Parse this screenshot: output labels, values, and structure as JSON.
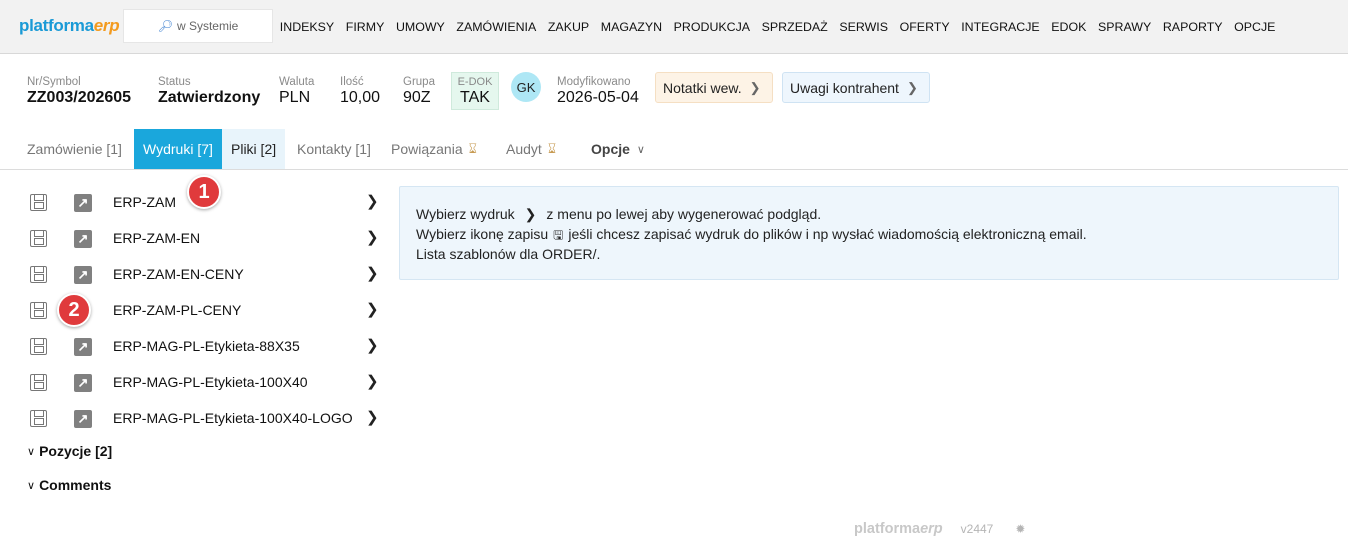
{
  "app": {
    "logo_part1": "platforma",
    "logo_part2": "erp",
    "search_placeholder": "w Systemie"
  },
  "nav": [
    "INDEKSY",
    "FIRMY",
    "UMOWY",
    "ZAMÓWIENIA",
    "ZAKUP",
    "MAGAZYN",
    "PRODUKCJA",
    "SPRZEDAŻ",
    "SERWIS",
    "OFERTY",
    "INTEGRACJE",
    "EDOK",
    "SPRAWY",
    "RAPORTY",
    "OPCJE"
  ],
  "header": {
    "symbol_label": "Nr/Symbol",
    "symbol_value": "ZZ003/202605",
    "status_label": "Status",
    "status_value": "Zatwierdzony",
    "currency_label": "Waluta",
    "currency_value": "PLN",
    "qty_label": "Ilość",
    "qty_value": "10,00",
    "group_label": "Grupa",
    "group_value": "90Z",
    "edok_label": "E-DOK",
    "edok_value": "TAK",
    "avatar": "GK",
    "modified_label": "Modyfikowano",
    "modified_value": "2026-05-04",
    "notes_button": "Notatki wew.",
    "remarks_button": "Uwagi kontrahent"
  },
  "tabs": {
    "order": "Zamówienie [1]",
    "prints": "Wydruki [7]",
    "files": "Pliki [2]",
    "contacts": "Kontakty [1]",
    "links": "Powiązania",
    "audit": "Audyt",
    "options": "Opcje"
  },
  "prints": [
    {
      "label": "ERP-ZAM"
    },
    {
      "label": "ERP-ZAM-EN"
    },
    {
      "label": "ERP-ZAM-EN-CENY"
    },
    {
      "label": "ERP-ZAM-PL-CENY"
    },
    {
      "label": "ERP-MAG-PL-Etykieta-88X35"
    },
    {
      "label": "ERP-MAG-PL-Etykieta-100X40"
    },
    {
      "label": "ERP-MAG-PL-Etykieta-100X40-LOGO"
    }
  ],
  "sections": {
    "items": "Pozycje [2]",
    "comments": "Comments"
  },
  "badges": {
    "first": "1",
    "second": "2"
  },
  "panel": {
    "line1_a": "Wybierz wydruk",
    "line1_b": "z menu po lewej aby wygenerować podgląd.",
    "line2_a": "Wybierz ikonę zapisu",
    "line2_b": "jeśli chcesz zapisać wydruk do plików i np wysłać wiadomością elektroniczną email.",
    "line3": "Lista szablonów dla ORDER/."
  },
  "footer": {
    "logo_part1": "platforma",
    "logo_part2": "erp",
    "version": "v2447"
  },
  "colors": {
    "accent": "#1aa7dc",
    "badge": "#e03a3c",
    "logo_blue": "#1a9ad6",
    "logo_orange": "#f39a1e"
  }
}
